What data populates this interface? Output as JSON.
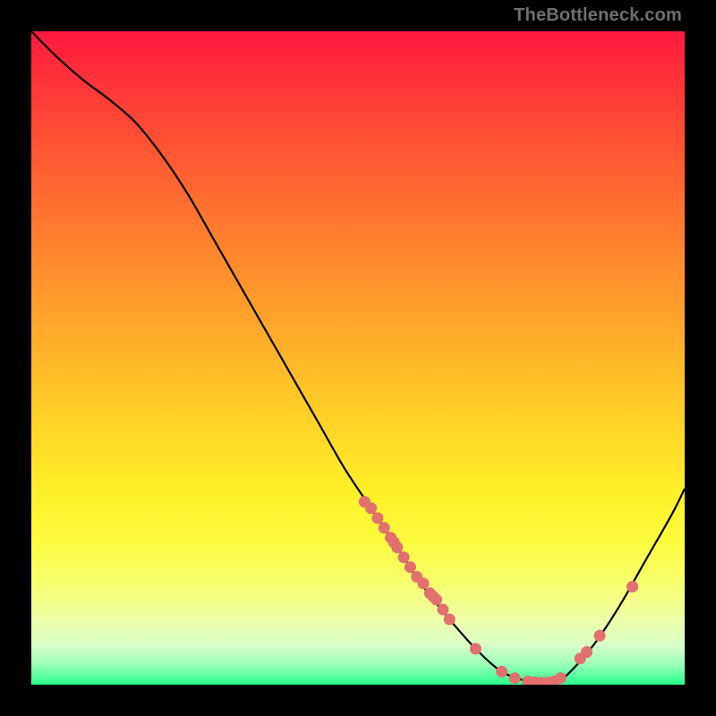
{
  "watermark": "TheBottleneck.com",
  "chart_data": {
    "type": "line",
    "title": "",
    "xlabel": "",
    "ylabel": "",
    "xlim": [
      0,
      100
    ],
    "ylim": [
      0,
      100
    ],
    "curve": [
      {
        "x": 0,
        "y": 100
      },
      {
        "x": 4,
        "y": 96
      },
      {
        "x": 8,
        "y": 92.5
      },
      {
        "x": 12,
        "y": 89.5
      },
      {
        "x": 16,
        "y": 86
      },
      {
        "x": 20,
        "y": 81
      },
      {
        "x": 24,
        "y": 75
      },
      {
        "x": 28,
        "y": 68
      },
      {
        "x": 32,
        "y": 61
      },
      {
        "x": 36,
        "y": 54
      },
      {
        "x": 40,
        "y": 47
      },
      {
        "x": 44,
        "y": 40
      },
      {
        "x": 48,
        "y": 33
      },
      {
        "x": 52,
        "y": 27
      },
      {
        "x": 56,
        "y": 21
      },
      {
        "x": 60,
        "y": 15
      },
      {
        "x": 64,
        "y": 10
      },
      {
        "x": 68,
        "y": 5.5
      },
      {
        "x": 72,
        "y": 2
      },
      {
        "x": 76,
        "y": 0.5
      },
      {
        "x": 78,
        "y": 0.3
      },
      {
        "x": 80,
        "y": 0.5
      },
      {
        "x": 82,
        "y": 1.5
      },
      {
        "x": 86,
        "y": 6
      },
      {
        "x": 90,
        "y": 12
      },
      {
        "x": 94,
        "y": 19
      },
      {
        "x": 98,
        "y": 26
      },
      {
        "x": 100,
        "y": 30
      }
    ],
    "markers": [
      {
        "x": 51,
        "y": 28
      },
      {
        "x": 52,
        "y": 27
      },
      {
        "x": 53,
        "y": 25.5
      },
      {
        "x": 54,
        "y": 24
      },
      {
        "x": 55,
        "y": 22.5
      },
      {
        "x": 55.5,
        "y": 21.8
      },
      {
        "x": 56,
        "y": 21
      },
      {
        "x": 57,
        "y": 19.5
      },
      {
        "x": 58,
        "y": 18
      },
      {
        "x": 59,
        "y": 16.5
      },
      {
        "x": 60,
        "y": 15.5
      },
      {
        "x": 61,
        "y": 14
      },
      {
        "x": 61.5,
        "y": 13.5
      },
      {
        "x": 62,
        "y": 13
      },
      {
        "x": 63,
        "y": 11.5
      },
      {
        "x": 64,
        "y": 10
      },
      {
        "x": 68,
        "y": 5.5
      },
      {
        "x": 72,
        "y": 2
      },
      {
        "x": 74,
        "y": 1
      },
      {
        "x": 76,
        "y": 0.5
      },
      {
        "x": 77,
        "y": 0.4
      },
      {
        "x": 78,
        "y": 0.3
      },
      {
        "x": 79,
        "y": 0.35
      },
      {
        "x": 80,
        "y": 0.5
      },
      {
        "x": 81,
        "y": 1
      },
      {
        "x": 84,
        "y": 4
      },
      {
        "x": 85,
        "y": 5
      },
      {
        "x": 87,
        "y": 7.5
      },
      {
        "x": 92,
        "y": 15
      }
    ],
    "marker_color": "#e2706e",
    "curve_color": "#000000",
    "gradient_stops": [
      {
        "offset": 0.0,
        "color": "#ff193e"
      },
      {
        "offset": 0.1,
        "color": "#ff3b38"
      },
      {
        "offset": 0.2,
        "color": "#ff5b33"
      },
      {
        "offset": 0.3,
        "color": "#ff7a2f"
      },
      {
        "offset": 0.4,
        "color": "#ff982c"
      },
      {
        "offset": 0.5,
        "color": "#ffb629"
      },
      {
        "offset": 0.6,
        "color": "#ffd327"
      },
      {
        "offset": 0.7,
        "color": "#ffee28"
      },
      {
        "offset": 0.78,
        "color": "#fcfc3d"
      },
      {
        "offset": 0.85,
        "color": "#f6ff72"
      },
      {
        "offset": 0.9,
        "color": "#eeffa8"
      },
      {
        "offset": 0.94,
        "color": "#d8ffc8"
      },
      {
        "offset": 0.97,
        "color": "#97ffb8"
      },
      {
        "offset": 1.0,
        "color": "#28ff8a"
      }
    ]
  }
}
